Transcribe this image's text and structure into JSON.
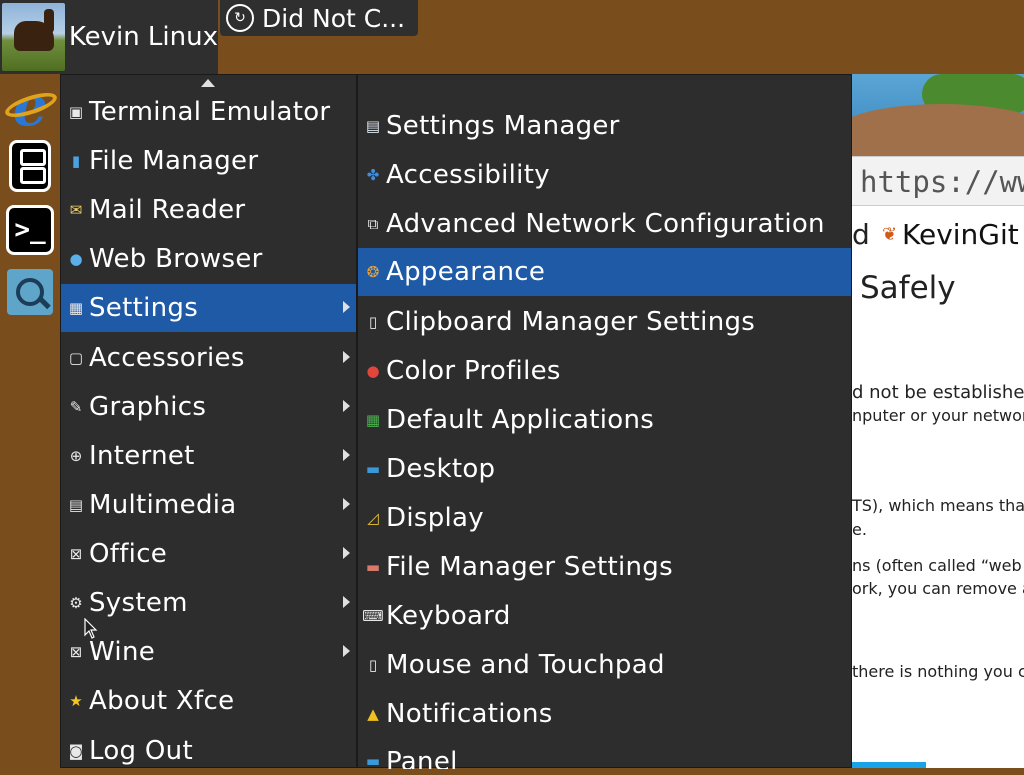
{
  "panel": {
    "user_label": "Kevin Linux",
    "task_label": "Did Not C..."
  },
  "dock": {
    "items": [
      {
        "icon": "internet-explorer-icon"
      },
      {
        "icon": "document-icon"
      },
      {
        "icon": "terminal-icon"
      },
      {
        "icon": "search-icon"
      }
    ]
  },
  "browser": {
    "url": "https://www",
    "bookmark_prefix": "d",
    "bookmark_label": "KevinGit",
    "error_title": "Safely",
    "lines": [
      "d not be established.",
      "nputer or your network",
      "TS), which means that",
      "e.",
      "ns (often called “web",
      "ork, you can remove and",
      "there is nothing you can"
    ]
  },
  "menu": {
    "items": [
      {
        "label": "Terminal Emulator",
        "icon": "terminal-icon",
        "has_submenu": false
      },
      {
        "label": "File Manager",
        "icon": "file-manager-icon",
        "has_submenu": false
      },
      {
        "label": "Mail Reader",
        "icon": "mail-icon",
        "has_submenu": false
      },
      {
        "label": "Web Browser",
        "icon": "web-browser-icon",
        "has_submenu": false
      },
      {
        "label": "Settings",
        "icon": "settings-icon",
        "has_submenu": true,
        "active": true
      },
      {
        "label": "Accessories",
        "icon": "accessories-icon",
        "has_submenu": true
      },
      {
        "label": "Graphics",
        "icon": "graphics-icon",
        "has_submenu": true
      },
      {
        "label": "Internet",
        "icon": "internet-icon",
        "has_submenu": true
      },
      {
        "label": "Multimedia",
        "icon": "multimedia-icon",
        "has_submenu": true
      },
      {
        "label": "Office",
        "icon": "office-icon",
        "has_submenu": true
      },
      {
        "label": "System",
        "icon": "system-gear-icon",
        "has_submenu": true
      },
      {
        "label": "Wine",
        "icon": "wine-icon",
        "has_submenu": true
      },
      {
        "label": "About Xfce",
        "icon": "star-icon",
        "has_submenu": false
      },
      {
        "label": "Log Out",
        "icon": "logout-icon",
        "has_submenu": false
      }
    ]
  },
  "submenu": {
    "items": [
      {
        "label": "Settings Manager",
        "icon": "settings-manager-icon"
      },
      {
        "label": "Accessibility",
        "icon": "accessibility-icon"
      },
      {
        "label": "Advanced Network Configuration",
        "icon": "network-icon"
      },
      {
        "label": "Appearance",
        "icon": "appearance-icon",
        "active": true
      },
      {
        "label": "Clipboard Manager Settings",
        "icon": "clipboard-icon"
      },
      {
        "label": "Color Profiles",
        "icon": "color-profiles-icon"
      },
      {
        "label": "Default Applications",
        "icon": "default-apps-icon"
      },
      {
        "label": "Desktop",
        "icon": "desktop-icon"
      },
      {
        "label": "Display",
        "icon": "display-icon"
      },
      {
        "label": "File Manager Settings",
        "icon": "file-manager-settings-icon"
      },
      {
        "label": "Keyboard",
        "icon": "keyboard-icon"
      },
      {
        "label": "Mouse and Touchpad",
        "icon": "mouse-icon"
      },
      {
        "label": "Notifications",
        "icon": "bell-icon"
      },
      {
        "label": "Panel",
        "icon": "panel-icon"
      }
    ]
  },
  "colors": {
    "desktop": "#7a4e1c",
    "menu_bg": "#2d2d2d",
    "highlight": "#1f5aa6"
  }
}
